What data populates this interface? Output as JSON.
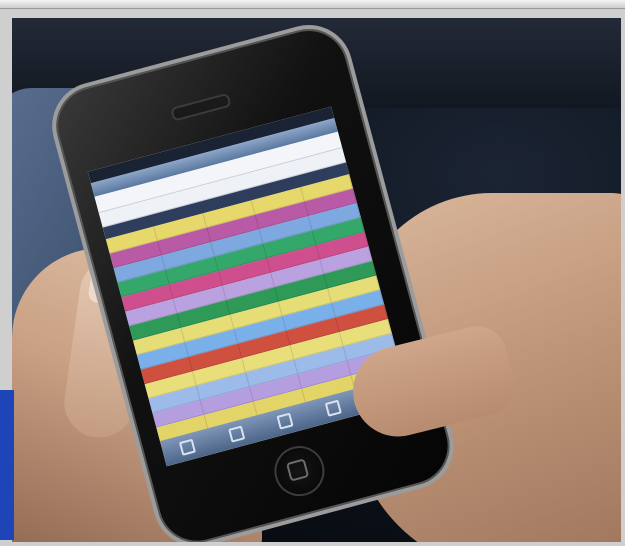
{
  "image": {
    "subject": "hands-holding-smartphone",
    "row_colors": [
      "#e6d86a",
      "#b85aa6",
      "#7ea8e0",
      "#34a86a",
      "#cf4f8e",
      "#b9a2df",
      "#2f9a58",
      "#e6dd77",
      "#7ab0ea",
      "#d0503f",
      "#e8df7b",
      "#9dbbe9",
      "#b59ee0",
      "#e3d468",
      "#ba7cd4",
      "#f0e68c",
      "#86b7ee"
    ],
    "colors": {
      "phone_body": "#0a0a0a",
      "phone_bezel": "#9c9c9c",
      "screen_bg": "#e6ebf2",
      "toolbar": "#5a789f",
      "skin": "#c9a083",
      "cloth": "#3f5372",
      "background": "#0c111a"
    }
  }
}
